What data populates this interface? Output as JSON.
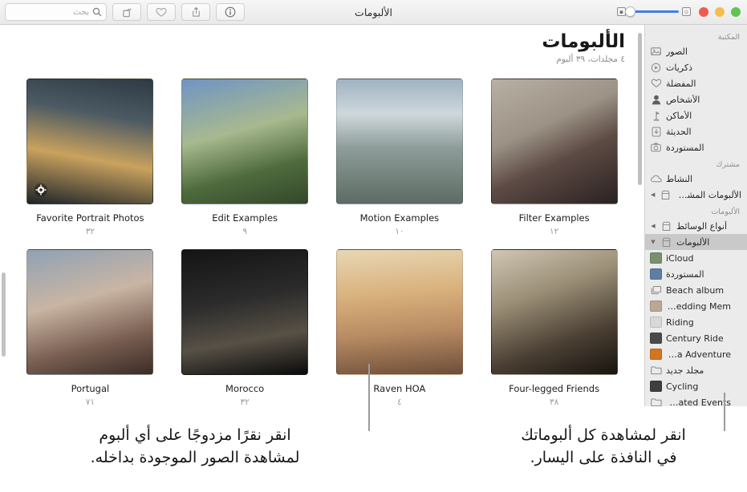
{
  "window": {
    "title": "الألبومات"
  },
  "toolbar": {
    "search": {
      "placeholder": "بحث",
      "value": ""
    },
    "buttons": [
      {
        "name": "rotate-button",
        "label": "تدوير"
      },
      {
        "name": "favorite-button",
        "label": "المفضلة"
      },
      {
        "name": "share-button",
        "label": "مشاركة"
      },
      {
        "name": "info-button",
        "label": "معلومات"
      }
    ],
    "zoom_slider": {
      "min_label": "مصغر",
      "max_label": "مكبر",
      "value": 0
    },
    "window_controls": {
      "close": "إغلاق",
      "minimize": "تصغير",
      "zoom": "تكبير"
    }
  },
  "sidebar": {
    "sections": [
      {
        "header": "المكتبة",
        "items": [
          {
            "label": "الصور",
            "icon": "photos-icon"
          },
          {
            "label": "ذكريات",
            "icon": "memories-icon"
          },
          {
            "label": "المفضلة",
            "icon": "heart-icon"
          },
          {
            "label": "الأشخاص",
            "icon": "person-icon"
          },
          {
            "label": "الأماكن",
            "icon": "places-pin-icon"
          },
          {
            "label": "الحديثة",
            "icon": "recents-icon"
          },
          {
            "label": "المستوردة",
            "icon": "imported-camera-icon"
          }
        ]
      },
      {
        "header": "مشترك",
        "items": [
          {
            "label": "النشاط",
            "icon": "cloud-icon"
          },
          {
            "label": "الألبومات المشتركة",
            "icon": "shared-albums-icon",
            "chevron": "◀"
          }
        ]
      },
      {
        "header": "الألبومات",
        "items": [
          {
            "label": "أنواع الوسائط",
            "icon": "media-types-icon",
            "chevron": "◀"
          },
          {
            "label": "الألبومات",
            "icon": "albums-icon",
            "chevron": "▼",
            "selected": true
          },
          {
            "label": "iCloud",
            "icon": "album-thumbnail",
            "indent": true,
            "thumb": "#7a8f6b"
          },
          {
            "label": "المستوردة",
            "icon": "album-thumbnail",
            "indent": true,
            "thumb": "#5d7fa3"
          },
          {
            "label": "Beach album",
            "icon": "stack-icon",
            "indent": true
          },
          {
            "label": "Wedding Mem...",
            "icon": "album-thumbnail",
            "indent": true,
            "thumb": "#b9a893"
          },
          {
            "label": "Riding",
            "icon": "album-thumbnail",
            "indent": true,
            "thumb": "#d8d8d8"
          },
          {
            "label": "Century Ride",
            "icon": "album-thumbnail",
            "indent": true,
            "thumb": "#4a4a4a"
          },
          {
            "label": "India Adventure",
            "icon": "album-thumbnail",
            "indent": true,
            "thumb": "#d2761f"
          },
          {
            "label": "مجلد جديد",
            "icon": "folder-icon",
            "indent": true
          },
          {
            "label": "Cycling",
            "icon": "album-thumbnail",
            "indent": true,
            "thumb": "#3f3f3f"
          },
          {
            "label": "Migrated Events",
            "icon": "folder-icon",
            "indent": true
          }
        ]
      }
    ]
  },
  "main": {
    "title": "الألبومات",
    "subtitle": "٤ مجلدات، ٣٩ ألبوم",
    "albums": [
      {
        "title": "Filter Examples",
        "count": "١٢",
        "badge": null
      },
      {
        "title": "Motion Examples",
        "count": "١٠",
        "badge": null
      },
      {
        "title": "Edit Examples",
        "count": "٩",
        "badge": null
      },
      {
        "title": "Favorite Portrait Photos",
        "count": "٣٢",
        "badge": "gear-icon"
      },
      {
        "title": "Four-legged Friends",
        "count": "٣٨",
        "badge": null
      },
      {
        "title": "Raven HOA",
        "count": "٤",
        "badge": null
      },
      {
        "title": "Morocco",
        "count": "٣٢",
        "badge": null
      },
      {
        "title": "Portugal",
        "count": "٧١",
        "badge": null
      }
    ]
  },
  "callouts": [
    {
      "id": "right-callout",
      "text": "انقر لمشاهدة كل ألبوماتك\nفي النافذة على اليسار."
    },
    {
      "id": "left-callout",
      "text": "انقر نقرًا مزدوجًا على أي ألبوم\nلمشاهدة الصور الموجودة بداخله."
    }
  ],
  "colors": {
    "accent": "#3f7fe8",
    "close": "#f05b50",
    "minimize": "#f4bd4f",
    "zoom": "#61c455",
    "sidebar_bg": "#ebebeb",
    "selection": "#c9c9c9"
  }
}
